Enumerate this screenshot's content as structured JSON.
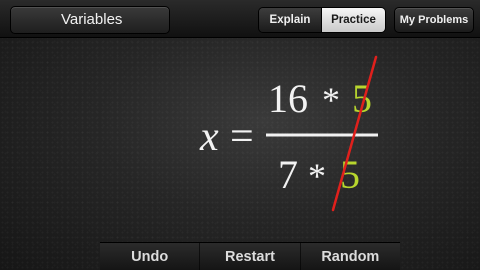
{
  "header": {
    "title": "Variables",
    "tabs": [
      {
        "label": "Explain",
        "selected": false
      },
      {
        "label": "Practice",
        "selected": true
      }
    ],
    "my_problems_label": "My Problems"
  },
  "equation": {
    "variable": "x",
    "equals": "=",
    "numerator": {
      "left": "16",
      "operator": "*",
      "cancelled": "5"
    },
    "denominator": {
      "left": "7",
      "operator": "*",
      "cancelled": "5"
    },
    "cancel_color": "#b8d62e",
    "strike_color": "#e0201c",
    "chalk_color": "#f2f2f2"
  },
  "footer": {
    "undo_label": "Undo",
    "restart_label": "Restart",
    "random_label": "Random"
  }
}
